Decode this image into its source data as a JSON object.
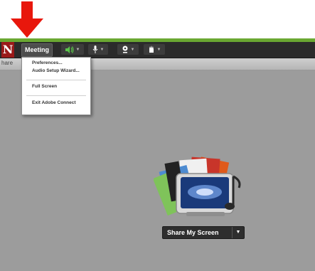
{
  "toolbar": {
    "logo_letter": "N",
    "meeting_label": "Meeting"
  },
  "subbar": {
    "label": "hare"
  },
  "menu": {
    "items": [
      "Preferences...",
      "Audio Setup Wizard...",
      "Full Screen",
      "Exit Adobe Connect"
    ]
  },
  "share": {
    "button_label": "Share My Screen"
  },
  "icons": {
    "audio": "speaker-icon",
    "mic": "microphone-icon",
    "cam": "webcam-icon",
    "raise": "raise-hand-icon",
    "annotation": "red-arrow-icon"
  },
  "colors": {
    "accent_green": "#6aa832",
    "toolbar_bg": "#2b2b2b",
    "workspace_bg": "#9c9c9c",
    "arrow_red": "#e8170c"
  }
}
